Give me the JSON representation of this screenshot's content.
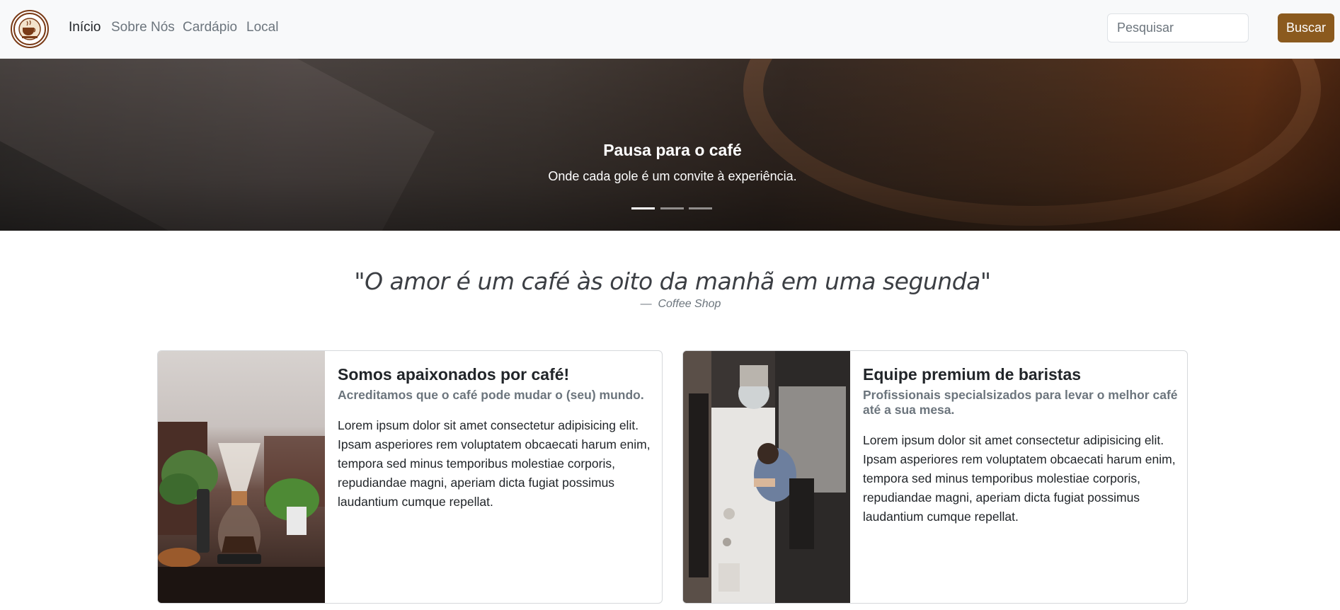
{
  "navbar": {
    "logo_icon": "coffee-cup-logo-icon",
    "links": [
      {
        "label": "Início",
        "active": true
      },
      {
        "label": "Sobre Nós",
        "active": false
      },
      {
        "label": "Cardápio",
        "active": false
      },
      {
        "label": "Local",
        "active": false
      }
    ],
    "search": {
      "placeholder": "Pesquisar",
      "value": ""
    },
    "search_button": "Buscar"
  },
  "hero": {
    "title": "Pausa para o café",
    "subtitle": "Onde cada gole é um convite à experiência.",
    "slide_count": 3,
    "active_slide": 1
  },
  "quote": {
    "text": "\"O amor é um café às oito da manhã em uma segunda\"",
    "dash": "—",
    "source": "Coffee Shop"
  },
  "cards": [
    {
      "image_icon": "chemex-coffee-photo",
      "title": "Somos apaixonados por café!",
      "subtitle": "Acreditamos que o café pode mudar o (seu) mundo.",
      "text": "Lorem ipsum dolor sit amet consectetur adipisicing elit. Ipsam asperiores rem voluptatem obcaecati harum enim, tempora sed minus temporibus molestiae corporis, repudiandae magni, aperiam dicta fugiat possimus laudantium cumque repellat."
    },
    {
      "image_icon": "barista-photo",
      "title": "Equipe premium de baristas",
      "subtitle": "Profissionais specialsizados para levar o melhor café até a sua mesa.",
      "text": "Lorem ipsum dolor sit amet consectetur adipisicing elit. Ipsam asperiores rem voluptatem obcaecati harum enim, tempora sed minus temporibus molestiae corporis, repudiandae magni, aperiam dicta fugiat possimus laudantium cumque repellat."
    }
  ],
  "colors": {
    "navbar_bg": "#f8f9fa",
    "brand_button": "#8b5a1e",
    "muted_text": "#6c757d"
  }
}
